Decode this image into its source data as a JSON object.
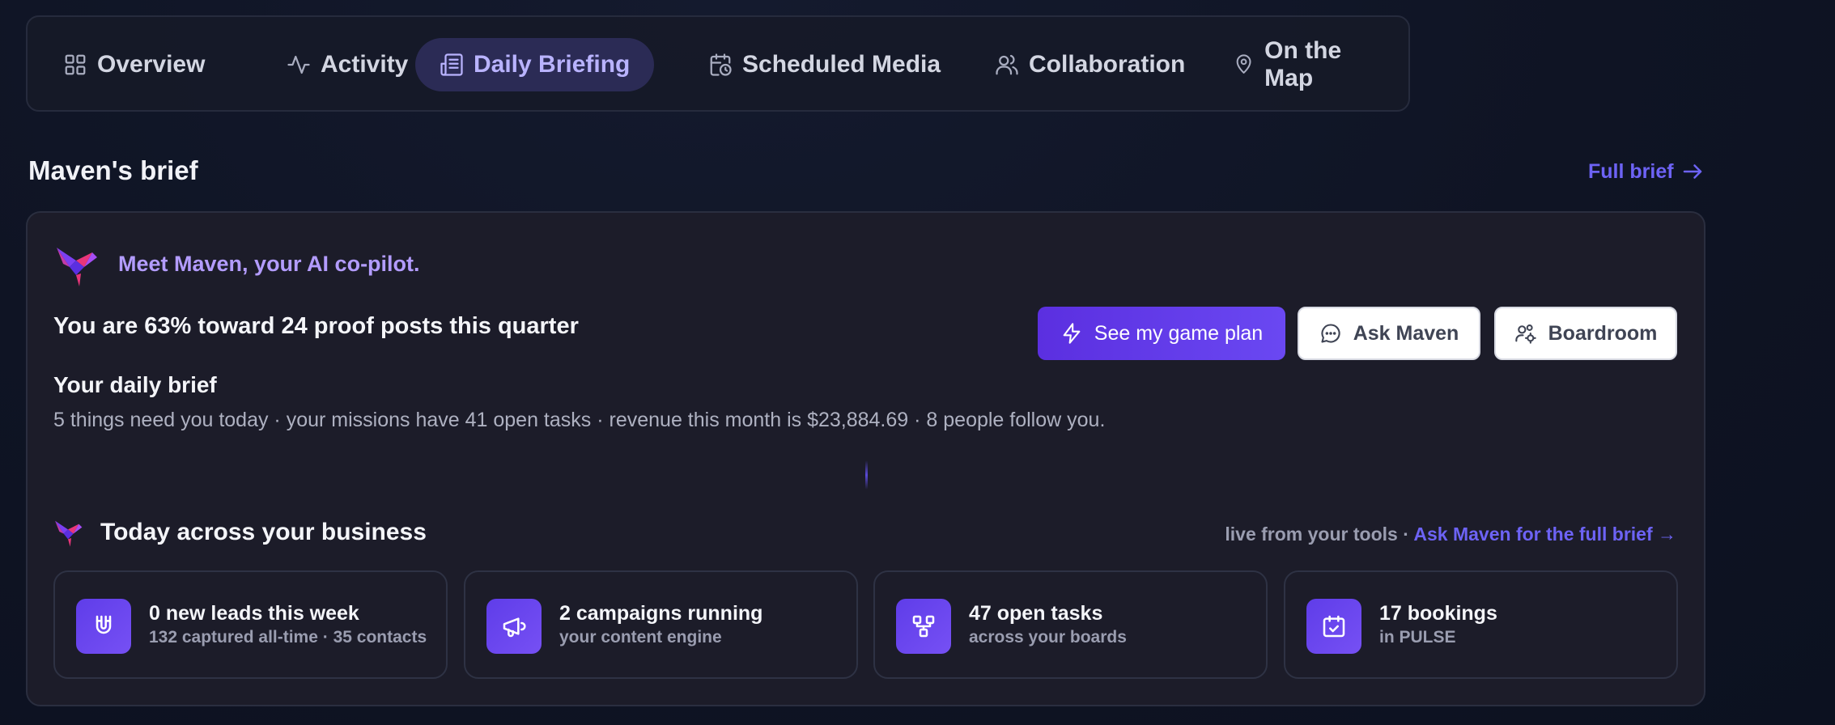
{
  "tabs": [
    {
      "label": "Overview",
      "icon": "grid-icon"
    },
    {
      "label": "Activity",
      "icon": "activity-icon"
    },
    {
      "label": "Daily Briefing",
      "icon": "newspaper-icon",
      "active": true
    },
    {
      "label": "Scheduled Media",
      "icon": "calendar-clock-icon"
    },
    {
      "label": "Collaboration",
      "icon": "users-icon"
    },
    {
      "label": "On the Map",
      "icon": "map-pin-icon"
    }
  ],
  "brief": {
    "section_title": "Maven's brief",
    "full_brief_label": "Full brief",
    "meet": "Meet Maven, your AI co-pilot.",
    "progress": "You are 63% toward 24 proof posts this quarter",
    "progress_percent": 63,
    "daily_title": "Your daily brief",
    "daily_text": "5 things need you today · your missions have 41 open tasks · revenue this month is $23,884.69 · 8 people follow you.",
    "buttons": {
      "game_plan": "See my game plan",
      "ask": "Ask Maven",
      "boardroom": "Boardroom"
    }
  },
  "today": {
    "title": "Today across your business",
    "live_prefix": "live from your tools · ",
    "ask_link": "Ask Maven for the full brief →",
    "stats": [
      {
        "value": "0 new leads this week",
        "sub": "132 captured all-time · 35 contacts",
        "icon": "magnet-icon"
      },
      {
        "value": "2 campaigns running",
        "sub": "your content engine",
        "icon": "megaphone-icon"
      },
      {
        "value": "47 open tasks",
        "sub": "across your boards",
        "icon": "workflow-icon"
      },
      {
        "value": "17 bookings",
        "sub": "in PULSE",
        "icon": "calendar-check-icon"
      }
    ]
  },
  "colors": {
    "accent": "#6d63f5",
    "primary_button": "#5b2fe0",
    "active_tab_bg": "#2b2b55",
    "card_bg": "#1c1c29",
    "page_bg": "#0f1424"
  }
}
